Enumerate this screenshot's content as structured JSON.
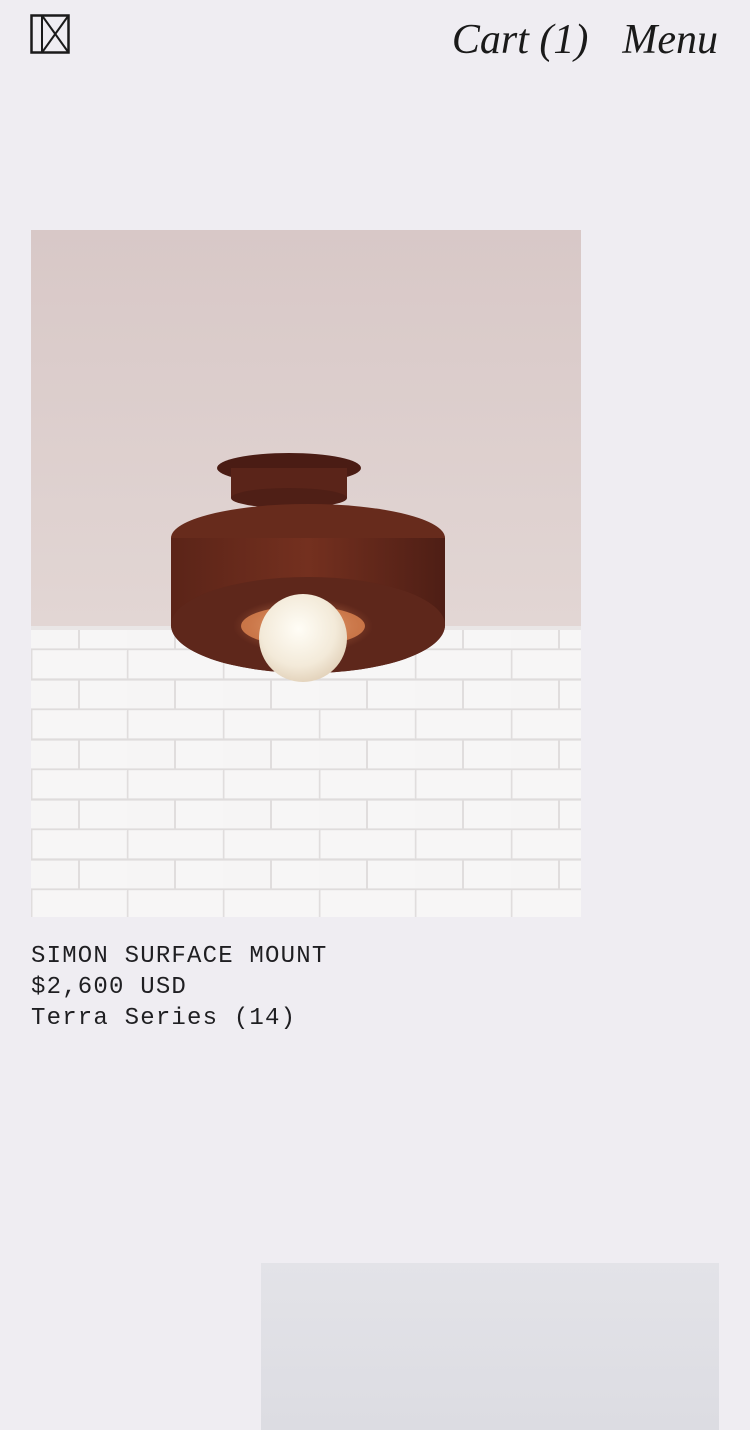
{
  "header": {
    "logo_name": "brand-logo",
    "cart_label": "Cart (1)",
    "menu_label": "Menu"
  },
  "product": {
    "name": "SIMON SURFACE MOUNT",
    "price": "$2,600 USD",
    "series": "Terra Series (14)"
  },
  "colors": {
    "background": "#efedf2",
    "text": "#1c1c1e",
    "lamp_shade": "#6b2a1c",
    "ceiling": "#d9cccb",
    "brick": "#f1f0f0"
  }
}
